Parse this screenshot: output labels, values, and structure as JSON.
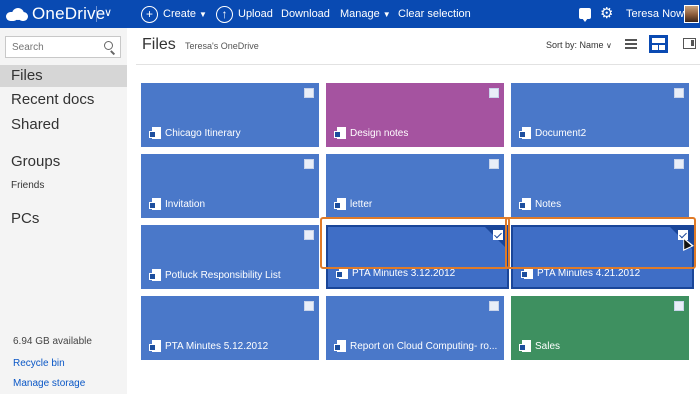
{
  "app": {
    "brand": "OneDrive"
  },
  "toolbar": {
    "create_label": "Create",
    "upload_label": "Upload",
    "download_label": "Download",
    "manage_label": "Manage",
    "clear_label": "Clear selection",
    "user_name": "Teresa Nowak",
    "icons": [
      "onedrive-cloud-icon",
      "chevron-down-icon",
      "plus-icon",
      "upload-arrow-icon",
      "notifications-icon",
      "gear-icon",
      "avatar"
    ],
    "bar_color": "#094ab2"
  },
  "sidebar": {
    "search_placeholder": "Search",
    "nav": {
      "files": "Files",
      "recent": "Recent docs",
      "shared": "Shared",
      "groups": "Groups",
      "friends": "Friends",
      "pcs": "PCs"
    },
    "storage": "6.94 GB available",
    "recycle": "Recycle bin",
    "manage_storage": "Manage storage"
  },
  "header": {
    "title": "Files",
    "breadcrumb": "Teresa's OneDrive",
    "sort_label": "Sort by: Name"
  },
  "tiles": [
    {
      "name": "Chicago Itinerary",
      "color": "#4a78c9",
      "selected": false
    },
    {
      "name": "Design notes",
      "color": "#a553a0",
      "selected": false
    },
    {
      "name": "Document2",
      "color": "#4a78c9",
      "selected": false
    },
    {
      "name": "Invitation",
      "color": "#4a78c9",
      "selected": false
    },
    {
      "name": "letter",
      "color": "#4a78c9",
      "selected": false
    },
    {
      "name": "Notes",
      "color": "#4a78c9",
      "selected": false
    },
    {
      "name": "Potluck Responsibility List",
      "color": "#4a78c9",
      "selected": false
    },
    {
      "name": "PTA Minutes 3.12.2012",
      "color": "#3f6ec6",
      "selected": true
    },
    {
      "name": "PTA Minutes 4.21.2012",
      "color": "#3f6ec6",
      "selected": true
    },
    {
      "name": "PTA Minutes 5.12.2012",
      "color": "#4a78c9",
      "selected": false
    },
    {
      "name": "Report on Cloud Computing- ro...",
      "color": "#4a78c9",
      "selected": false
    },
    {
      "name": "Sales",
      "color": "#3e9060",
      "selected": false
    }
  ],
  "colors": {
    "highlight": "#e07b28",
    "selection": "#1a4699"
  }
}
